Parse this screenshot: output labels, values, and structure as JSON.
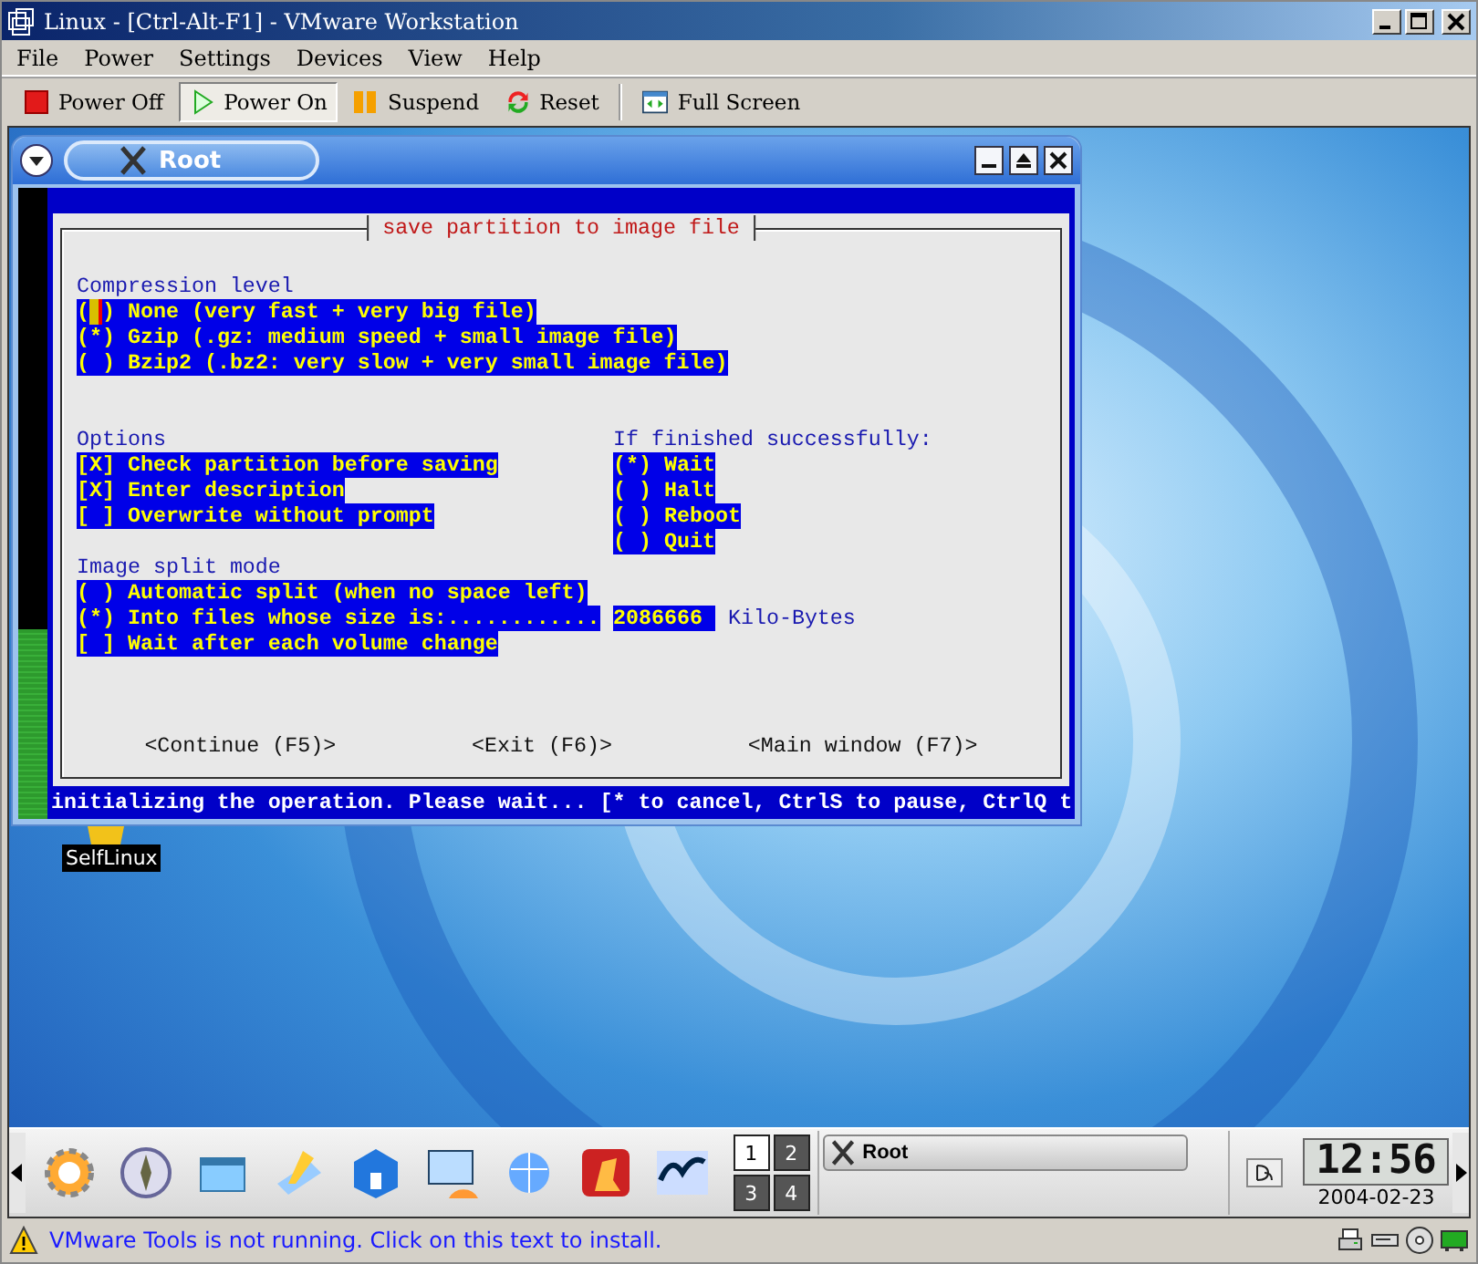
{
  "window": {
    "title": "Linux - [Ctrl-Alt-F1] - VMware Workstation"
  },
  "menu": [
    "File",
    "Power",
    "Settings",
    "Devices",
    "View",
    "Help"
  ],
  "toolbar": [
    {
      "label": "Power Off",
      "kind": "stop",
      "selected": false
    },
    {
      "label": "Power On",
      "kind": "play",
      "selected": true
    },
    {
      "label": "Suspend",
      "kind": "pause",
      "selected": false
    },
    {
      "label": "Reset",
      "kind": "reset",
      "selected": false
    },
    {
      "label": "Full Screen",
      "kind": "fullscreen",
      "selected": false
    }
  ],
  "guest_window": {
    "title": "Root"
  },
  "dialog": {
    "title": "save partition to image file",
    "compression": {
      "label": "Compression level",
      "options": [
        {
          "text": "( ) None (very fast + very big file)",
          "focused": true
        },
        {
          "text": "(*) Gzip (.gz: medium speed + small image file)",
          "focused": false
        },
        {
          "text": "( ) Bzip2 (.bz2: very slow + very small image file)",
          "focused": false
        }
      ]
    },
    "options": {
      "label": "Options",
      "items": [
        "[X] Check partition before saving",
        "[X] Enter description",
        "[ ] Overwrite without prompt"
      ]
    },
    "finish": {
      "label": "If finished successfully:",
      "items": [
        "(*) Wait",
        "( ) Halt",
        "( ) Reboot",
        "( ) Quit"
      ]
    },
    "split": {
      "label": "Image split mode",
      "items": [
        "( ) Automatic split (when no space left)",
        "(*) Into files whose size is:............",
        "[ ] Wait after each volume change"
      ],
      "size_value": "2086666",
      "size_unit": "Kilo-Bytes"
    },
    "buttons": [
      "<Continue (F5)>",
      "<Exit (F6)>",
      "<Main window (F7)>"
    ]
  },
  "terminal_status": "initializing the operation. Please wait... [* to cancel, CtrlS to pause, CtrlQ t",
  "desktop_icon": {
    "label": "SelfLinux"
  },
  "panel": {
    "pager": [
      {
        "label": "1",
        "selected": true
      },
      {
        "label": "2",
        "selected": false
      },
      {
        "label": "3",
        "selected": false
      },
      {
        "label": "4",
        "selected": false
      }
    ],
    "task": "Root",
    "clock": {
      "time": "12:56",
      "date": "2004-02-23"
    }
  },
  "status_bar": {
    "message": "VMware Tools is not running. Click on this text to install."
  }
}
